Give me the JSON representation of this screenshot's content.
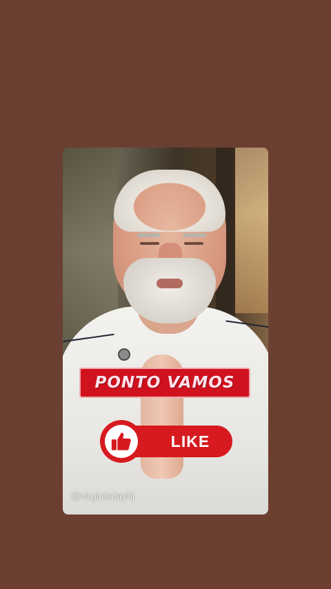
{
  "video": {
    "banner_text": "PONTO VAMOS",
    "like_label": "LIKE",
    "watermark": "@virginiadayhj",
    "icon": "thumbs-up-icon"
  },
  "colors": {
    "page_background": "#6b3f31",
    "banner_red": "#d0121e",
    "like_red": "#d61a1f",
    "banner_text": "#ffe2ec"
  }
}
